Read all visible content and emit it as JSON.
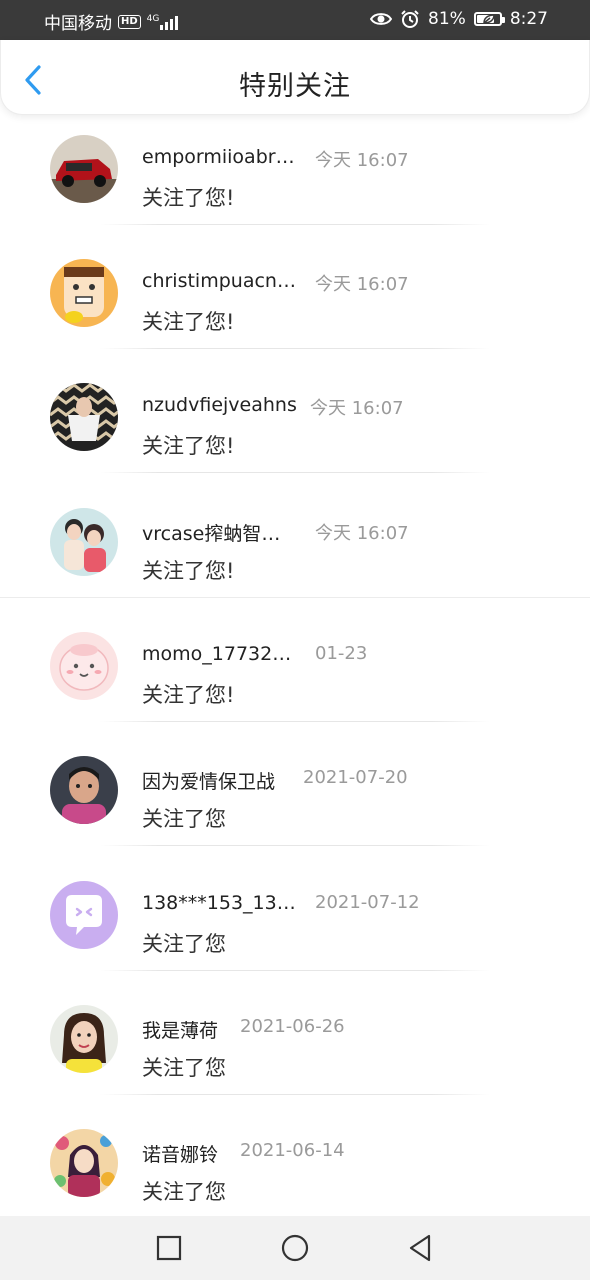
{
  "status_bar": {
    "carrier": "中国移动",
    "hd_label": "HD",
    "network": "4G",
    "battery_percent_text": "81%",
    "battery_level": 0.81,
    "time": "8:27"
  },
  "header": {
    "title": "特别关注",
    "back_icon": "chevron-left-icon",
    "accent_color": "#2f9bf0"
  },
  "notifications": [
    {
      "name": "empormiioabr…",
      "time": "今天 16:07",
      "action": "关注了您!"
    },
    {
      "name": "christimpuacn…",
      "time": "今天 16:07",
      "action": "关注了您!"
    },
    {
      "name": "nzudvfiejveahns",
      "time": "今天 16:07",
      "action": "关注了您!"
    },
    {
      "name": "vrcase搾蚋智…",
      "time": "今天 16:07",
      "action": "关注了您!"
    },
    {
      "name": "momo_17732…",
      "time": "01-23",
      "action": "关注了您!"
    },
    {
      "name": "因为爱情保卫战",
      "time": "2021-07-20",
      "action": "关注了您"
    },
    {
      "name": "138***153_13…",
      "time": "2021-07-12",
      "action": "关注了您"
    },
    {
      "name": "我是薄荷",
      "time": "2021-06-26",
      "action": "关注了您"
    },
    {
      "name": "诺音娜铃",
      "time": "2021-06-14",
      "action": "关注了您"
    }
  ],
  "nav_bar": {
    "recent_icon": "square-icon",
    "home_icon": "circle-icon",
    "back_icon": "triangle-back-icon"
  }
}
